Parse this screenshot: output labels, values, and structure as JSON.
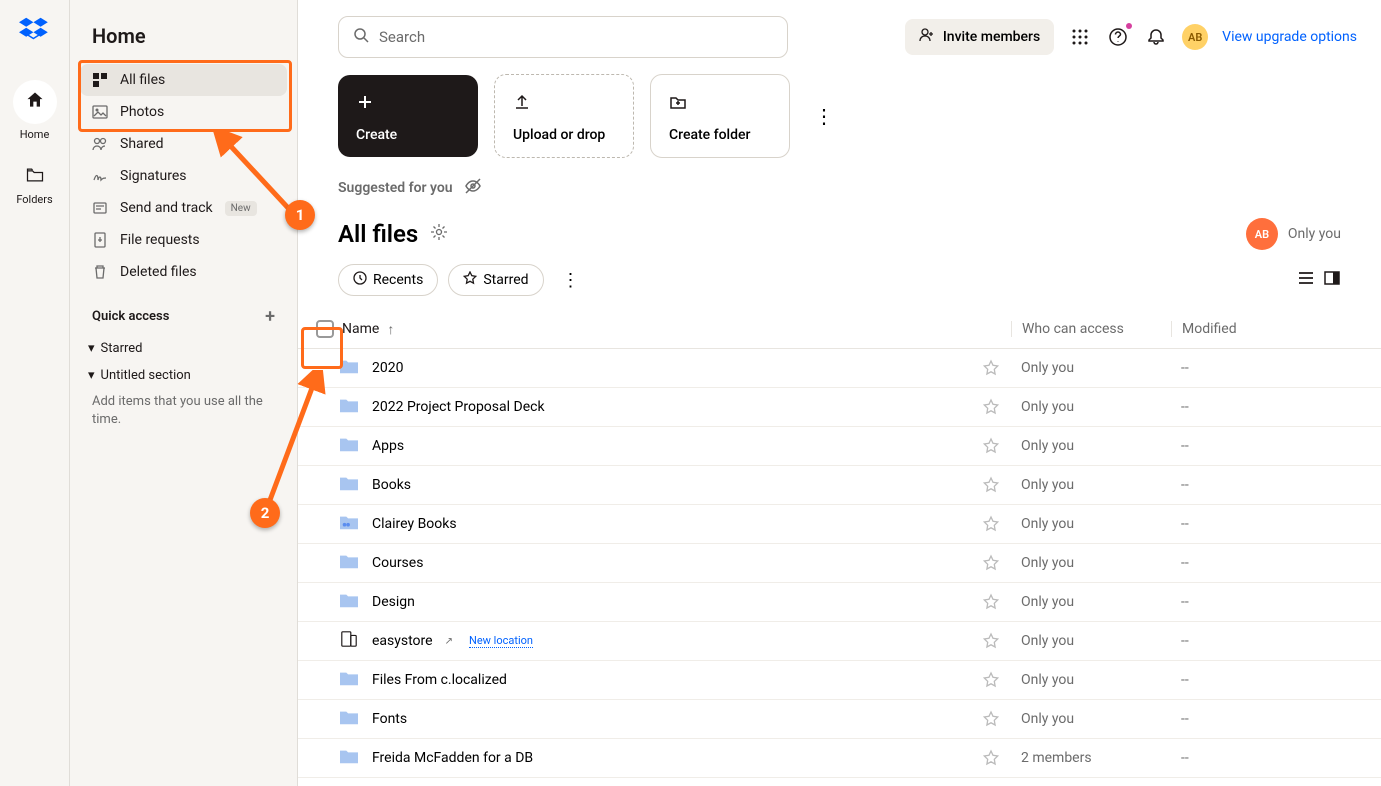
{
  "rail": {
    "home": "Home",
    "folders": "Folders"
  },
  "sidebar": {
    "title": "Home",
    "items": [
      {
        "label": "All files"
      },
      {
        "label": "Photos"
      },
      {
        "label": "Shared"
      },
      {
        "label": "Signatures"
      },
      {
        "label": "Send and track",
        "badge": "New"
      },
      {
        "label": "File requests"
      },
      {
        "label": "Deleted files"
      }
    ],
    "quick_access": "Quick access",
    "starred": "Starred",
    "untitled": "Untitled section",
    "hint": "Add items that you use all the time."
  },
  "header": {
    "search_placeholder": "Search",
    "invite": "Invite members",
    "avatar": "AB",
    "upgrade": "View upgrade options"
  },
  "actions": {
    "create": "Create",
    "upload": "Upload or drop",
    "folder": "Create folder"
  },
  "suggested": "Suggested for you",
  "page": {
    "title": "All files",
    "only_you": "Only you",
    "avatar": "AB"
  },
  "filters": {
    "recents": "Recents",
    "starred": "Starred"
  },
  "table": {
    "name": "Name",
    "access": "Who can access",
    "modified": "Modified"
  },
  "files": [
    {
      "name": "2020",
      "type": "folder",
      "access": "Only you",
      "modified": "--"
    },
    {
      "name": "2022 Project Proposal Deck",
      "type": "folder",
      "access": "Only you",
      "modified": "--"
    },
    {
      "name": "Apps",
      "type": "folder",
      "access": "Only you",
      "modified": "--"
    },
    {
      "name": "Books",
      "type": "folder",
      "access": "Only you",
      "modified": "--"
    },
    {
      "name": "Clairey Books",
      "type": "folder-shared",
      "access": "Only you",
      "modified": "--"
    },
    {
      "name": "Courses",
      "type": "folder",
      "access": "Only you",
      "modified": "--"
    },
    {
      "name": "Design",
      "type": "folder",
      "access": "Only you",
      "modified": "--"
    },
    {
      "name": "easystore",
      "type": "device",
      "badge": "New location",
      "access": "Only you",
      "modified": "--"
    },
    {
      "name": "Files From c.localized",
      "type": "folder",
      "access": "Only you",
      "modified": "--"
    },
    {
      "name": "Fonts",
      "type": "folder",
      "access": "Only you",
      "modified": "--"
    },
    {
      "name": "Freida McFadden for a DB",
      "type": "folder",
      "access": "2 members",
      "modified": "--"
    }
  ],
  "annotations": {
    "n1": "1",
    "n2": "2"
  }
}
